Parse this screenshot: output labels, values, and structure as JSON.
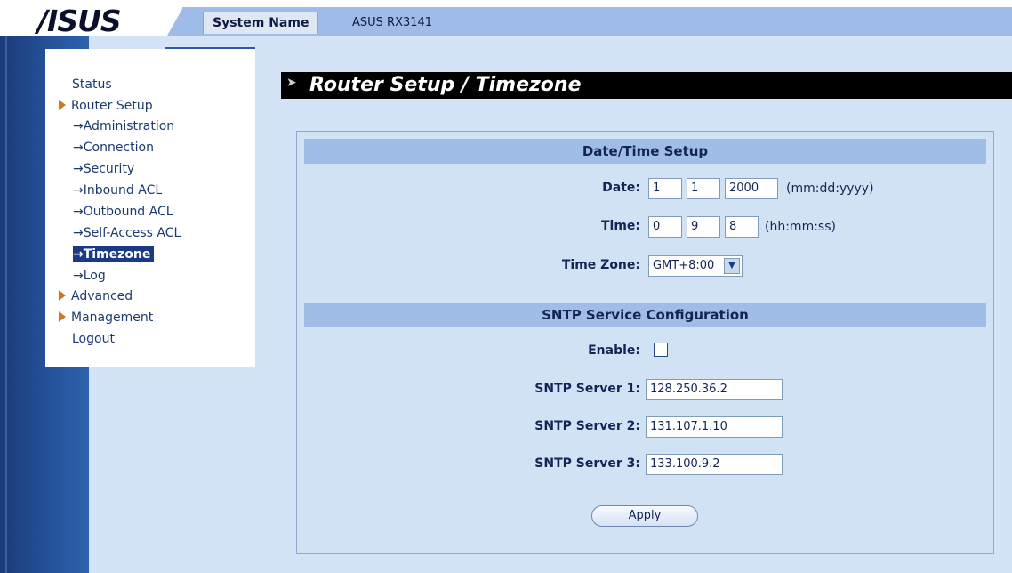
{
  "header": {
    "logo_text": "/ISUS",
    "system_name_label": "System Name",
    "system_name_value": "ASUS RX3141"
  },
  "menu": {
    "status": "Status",
    "router_setup": "Router Setup",
    "sub_items": [
      "→Administration",
      "→Connection",
      "→Security",
      "→Inbound ACL",
      "→Outbound ACL",
      "→Self-Access ACL",
      "→Timezone",
      "→Log"
    ],
    "advanced": "Advanced",
    "management": "Management",
    "logout": "Logout"
  },
  "page": {
    "title": "Router Setup / Timezone"
  },
  "datetime": {
    "section_title": "Date/Time Setup",
    "date_label": "Date:",
    "date_mm": "1",
    "date_dd": "1",
    "date_yyyy": "2000",
    "date_hint": "(mm:dd:yyyy)",
    "time_label": "Time:",
    "time_hh": "0",
    "time_mm": "9",
    "time_ss": "8",
    "time_hint": "(hh:mm:ss)",
    "timezone_label": "Time Zone:",
    "timezone_value": "GMT+8:00"
  },
  "sntp": {
    "section_title": "SNTP Service Configuration",
    "enable_label": "Enable:",
    "enabled": false,
    "server1_label": "SNTP Server 1:",
    "server1_value": "128.250.36.2",
    "server2_label": "SNTP Server 2:",
    "server2_value": "131.107.1.10",
    "server3_label": "SNTP Server 3:",
    "server3_value": "133.100.9.2"
  },
  "actions": {
    "apply_label": "Apply"
  },
  "colors": {
    "accent_orange": "#d07820",
    "nav_blue": "#1a3a86",
    "section_head": "#9fbde6"
  }
}
